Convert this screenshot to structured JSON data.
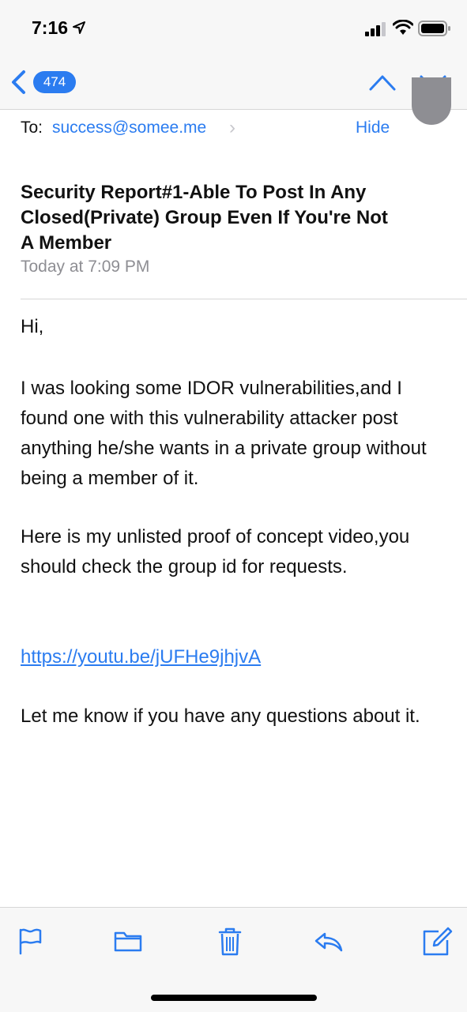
{
  "status": {
    "time": "7:16"
  },
  "nav": {
    "message_count": "474"
  },
  "header": {
    "to_label": "To:",
    "to_address": "success@somee.me",
    "hide_label": "Hide",
    "subject": "Security Report#1-Able To Post In Any Closed(Private) Group Even If You're Not A Member",
    "date": "Today at 7:09 PM"
  },
  "body": {
    "greeting": "Hi,",
    "paragraph1": "I was looking some IDOR vulnerabilities,and I found one with this vulnerability attacker post anything he/she wants in a private group without being a member of it.",
    "paragraph2": "Here is my unlisted proof of concept video,you should check the group id for requests.",
    "link": "https://youtu.be/jUFHe9jhjvA",
    "paragraph3": "Let me know if you have any questions about it."
  },
  "toolbar": {
    "icons": [
      "flag-icon",
      "folder-icon",
      "trash-icon",
      "reply-icon",
      "compose-icon"
    ]
  },
  "colors": {
    "accent": "#2b7cf0",
    "secondary_text": "#8e8e93",
    "bar_background": "#f7f7f7"
  }
}
